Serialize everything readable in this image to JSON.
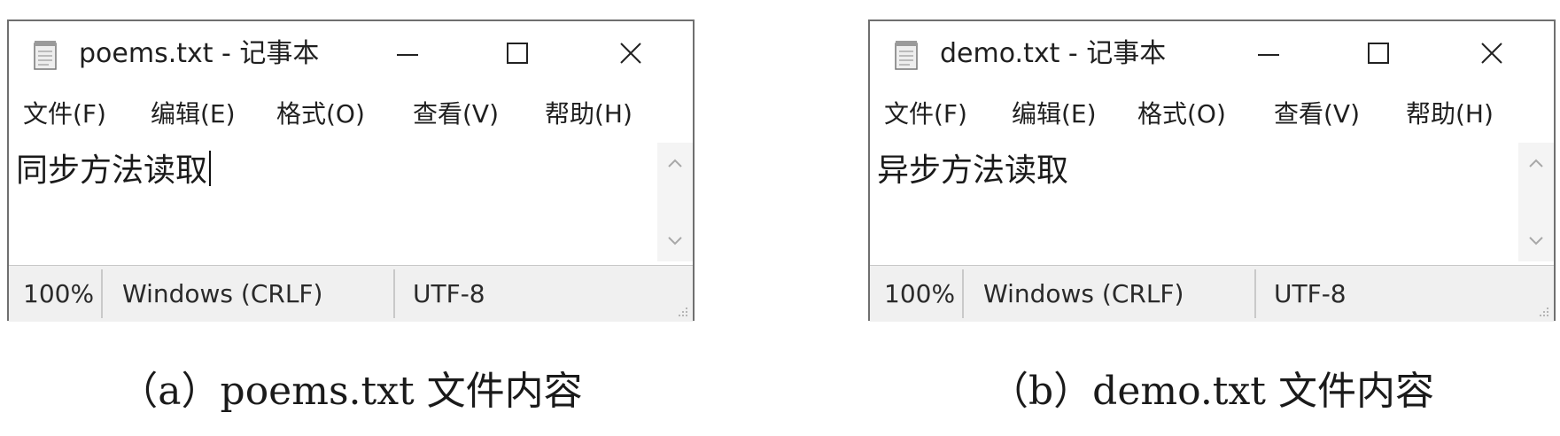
{
  "windows": [
    {
      "title": "poems.txt - 记事本",
      "menu": [
        "文件(F)",
        "编辑(E)",
        "格式(O)",
        "查看(V)",
        "帮助(H)"
      ],
      "content": "同步方法读取",
      "status": {
        "zoom": "100%",
        "line_ending": "Windows (CRLF)",
        "encoding": "UTF-8"
      },
      "caption": "（a）poems.txt 文件内容"
    },
    {
      "title": "demo.txt - 记事本",
      "menu": [
        "文件(F)",
        "编辑(E)",
        "格式(O)",
        "查看(V)",
        "帮助(H)"
      ],
      "content": "异步方法读取",
      "status": {
        "zoom": "100%",
        "line_ending": "Windows (CRLF)",
        "encoding": "UTF-8"
      },
      "caption": "（b）demo.txt 文件内容"
    }
  ],
  "icons": {
    "app": "notepad-icon",
    "minimize": "minimize-icon",
    "maximize": "maximize-icon",
    "close": "close-icon",
    "scroll_up": "chevron-up-icon",
    "scroll_down": "chevron-down-icon",
    "grip": "resize-grip-icon"
  },
  "colors": {
    "border": "#6f6f6f",
    "statusbar": "#f0f0f0",
    "scrollbar": "#f4f4f4"
  }
}
